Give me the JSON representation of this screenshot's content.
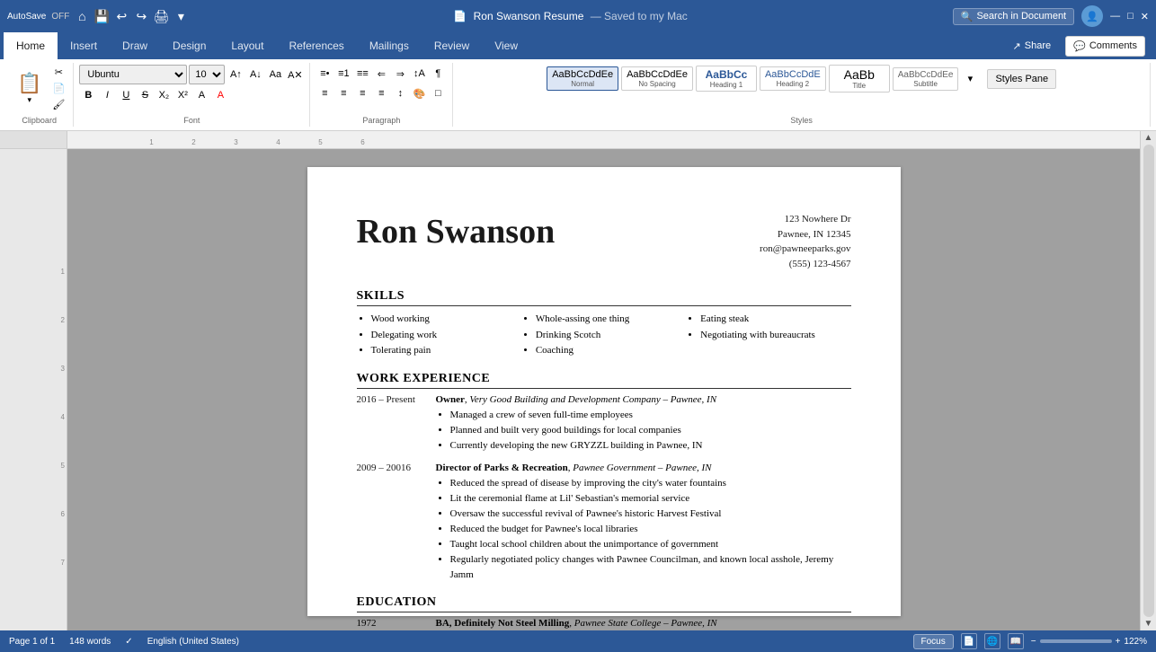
{
  "titleBar": {
    "autosave": "AutoSave",
    "autosaveState": "OFF",
    "title": "Ron Swanson Resume",
    "savedStatus": "— Saved to my Mac",
    "searchPlaceholder": "Search in Document"
  },
  "ribbon": {
    "tabs": [
      "Home",
      "Insert",
      "Draw",
      "Design",
      "Layout",
      "References",
      "Mailings",
      "Review",
      "View"
    ],
    "activeTab": "Home",
    "shareLabel": "Share",
    "commentsLabel": "Comments",
    "stylesPane": "Styles Pane"
  },
  "toolbar": {
    "pasteLabel": "Paste",
    "fontName": "Ubuntu",
    "fontSize": "10",
    "styles": [
      {
        "preview": "AaBbCcDdEe",
        "label": "Normal",
        "active": true
      },
      {
        "preview": "AaBbCcDdEe",
        "label": "No Spacing",
        "active": false
      },
      {
        "preview": "AaBbCc",
        "label": "Heading 1",
        "active": false
      },
      {
        "preview": "AaBbCcDdE",
        "label": "Heading 2",
        "active": false
      },
      {
        "preview": "AaBb",
        "label": "Title",
        "active": false
      },
      {
        "preview": "AaBbCcDdEe",
        "label": "Subtitle",
        "active": false
      }
    ]
  },
  "document": {
    "name": {
      "first": "Ron",
      "last": "Swanson"
    },
    "nameDisplay": "Ron Swanson",
    "address": {
      "street": "123 Nowhere Dr",
      "cityState": "Pawnee, IN 12345",
      "email": "ron@pawneeparks.gov",
      "phone": "(555) 123-4567"
    },
    "sections": {
      "skills": {
        "title": "SKILLS",
        "columns": [
          [
            "Wood working",
            "Delegating work",
            "Tolerating pain"
          ],
          [
            "Whole-assing one thing",
            "Drinking Scotch",
            "Coaching"
          ],
          [
            "Eating steak",
            "Negotiating with bureaucrats"
          ]
        ]
      },
      "workExperience": {
        "title": "WORK EXPERIENCE",
        "entries": [
          {
            "dates": "2016 – Present",
            "title": "Owner",
            "company": "Very Good Building and Development Company – Pawnee, IN",
            "bullets": [
              "Managed a crew of seven full-time employees",
              "Planned and built very good buildings for local companies",
              "Currently developing the new GRYZZL building in Pawnee, IN"
            ]
          },
          {
            "dates": "2009 – 20016",
            "title": "Director of Parks & Recreation",
            "company": "Pawnee Government – Pawnee, IN",
            "bullets": [
              "Reduced the spread of disease by improving the city's water fountains",
              "Lit the ceremonial flame at Lil' Sebastian's memorial service",
              "Oversaw the successful revival of Pawnee's historic Harvest Festival",
              "Reduced the budget for Pawnee's local libraries",
              "Taught local school children about the unimportance of government",
              "Regularly negotiated policy changes with Pawnee Councilman, and known local asshole, Jeremy Jamm"
            ]
          }
        ]
      },
      "education": {
        "title": "EDUCATION",
        "entries": [
          {
            "year": "1972",
            "degree": "BA, Definitely Not Steel Milling",
            "school": "Pawnee State College – Pawnee, IN"
          }
        ]
      }
    }
  },
  "statusBar": {
    "pageInfo": "Page 1 of 1",
    "wordCount": "148 words",
    "language": "English (United States)",
    "focusLabel": "Focus",
    "zoomLevel": "122%"
  }
}
